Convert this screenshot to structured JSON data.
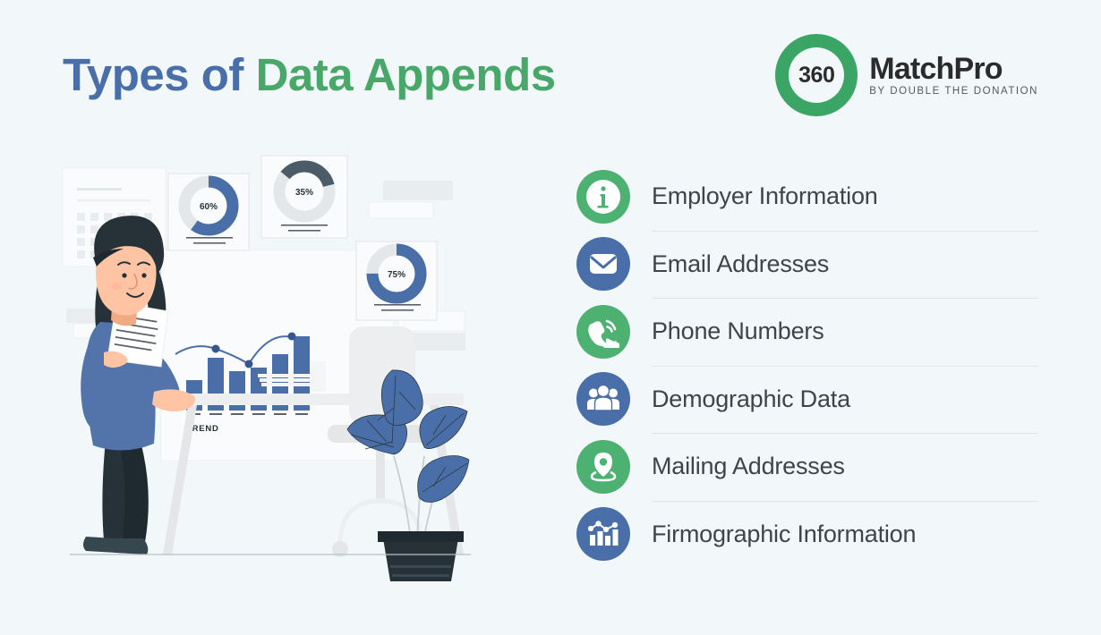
{
  "background_color": "#f2f7fa",
  "header": {
    "title_part_1": "Types of ",
    "title_part_2": "Data Appends",
    "title_color_1": "#4a6fa8",
    "title_color_2": "#49a869"
  },
  "logo": {
    "badge_text": "360",
    "brand_name": "MatchPro",
    "tagline": "BY DOUBLE THE DONATION",
    "ring_color": "#3aa564"
  },
  "list": {
    "items": [
      {
        "label": "Employer Information",
        "icon": "info-icon",
        "icon_color": "#4cb171",
        "icon_style": "green"
      },
      {
        "label": "Email Addresses",
        "icon": "envelope-icon",
        "icon_color": "#4a6fa8",
        "icon_style": "blue"
      },
      {
        "label": "Phone Numbers",
        "icon": "phone-icon",
        "icon_color": "#4cb171",
        "icon_style": "green"
      },
      {
        "label": "Demographic Data",
        "icon": "people-icon",
        "icon_color": "#4a6fa8",
        "icon_style": "blue"
      },
      {
        "label": "Mailing Addresses",
        "icon": "map-pin-icon",
        "icon_color": "#4cb171",
        "icon_style": "green"
      },
      {
        "label": "Firmographic Information",
        "icon": "bar-chart-icon",
        "icon_color": "#4a6fa8",
        "icon_style": "blue"
      }
    ]
  },
  "illustration": {
    "alt": "woman presenting data dashboards in an office",
    "trend_label": "TREND",
    "donuts": [
      {
        "label": "60%",
        "value": 60
      },
      {
        "label": "35%",
        "value": 35
      },
      {
        "label": "75%",
        "value": 75
      }
    ],
    "colors": {
      "accent_blue": "#4a6fa8",
      "dark_navy": "#263238",
      "skin": "#ffc4a3",
      "card": "#fafbfc",
      "gray": "#e6e6e6"
    }
  },
  "chart_data": [
    {
      "type": "pie",
      "title": "60%",
      "categories": [
        "filled",
        "remaining"
      ],
      "values": [
        60,
        40
      ],
      "legend": "none"
    },
    {
      "type": "pie",
      "title": "35%",
      "categories": [
        "filled",
        "remaining"
      ],
      "values": [
        35,
        65
      ],
      "legend": "none"
    },
    {
      "type": "pie",
      "title": "75%",
      "categories": [
        "filled",
        "remaining"
      ],
      "values": [
        75,
        25
      ],
      "legend": "none"
    },
    {
      "type": "bar",
      "title": "TREND",
      "categories": [
        "1",
        "2",
        "3",
        "4",
        "5",
        "6"
      ],
      "values": [
        26,
        62,
        40,
        48,
        72,
        100
      ],
      "xlabel": "",
      "ylabel": "",
      "ylim": [
        0,
        110
      ],
      "grid": false,
      "legend": "none"
    }
  ]
}
